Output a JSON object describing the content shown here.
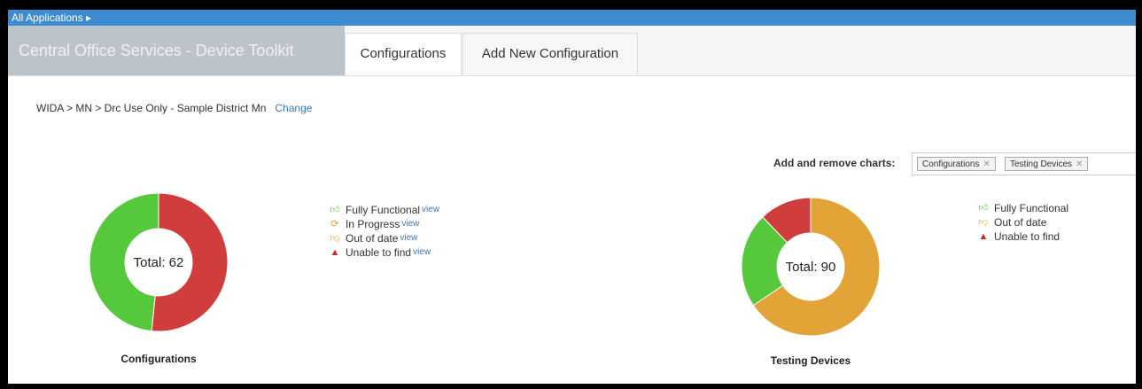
{
  "topbar": {
    "label": "All Applications ▸"
  },
  "app": {
    "title": "Central Office Services - Device Toolkit"
  },
  "tabs": [
    {
      "label": "Configurations",
      "active": true
    },
    {
      "label": "Add New Configuration",
      "active": false
    }
  ],
  "breadcrumb": {
    "path": "WIDA > MN > Drc Use Only - Sample District Mn",
    "change_label": "Change"
  },
  "add_charts": {
    "label": "Add and remove charts:",
    "tags": [
      "Configurations",
      "Testing Devices"
    ]
  },
  "colors": {
    "green": "#55c83c",
    "red": "#d13c3c",
    "orange": "#e2a437",
    "accent": "#3d8bd1"
  },
  "legends": {
    "configurations": [
      {
        "label": "Fully Functional",
        "link": "view",
        "icon": "thumbs-up-icon"
      },
      {
        "label": "In Progress",
        "link": "view",
        "icon": "refresh-icon"
      },
      {
        "label": "Out of date",
        "link": "view",
        "icon": "thumbs-down-icon"
      },
      {
        "label": "Unable to find",
        "link": "view",
        "icon": "warning-icon"
      }
    ],
    "testing": [
      {
        "label": "Fully Functional",
        "icon": "thumbs-up-icon"
      },
      {
        "label": "Out of date",
        "icon": "thumbs-down-icon"
      },
      {
        "label": "Unable to find",
        "icon": "warning-icon"
      }
    ]
  },
  "chart_data": [
    {
      "type": "pie",
      "title": "Configurations",
      "center_label": "Total: 62",
      "total": 62,
      "slices": [
        {
          "name": "Out of date",
          "value": 32,
          "color": "#d13c3c"
        },
        {
          "name": "Fully Functional",
          "value": 30,
          "color": "#55c83c"
        }
      ]
    },
    {
      "type": "pie",
      "title": "Testing Devices",
      "center_label": "Total: 90",
      "total": 90,
      "slices": [
        {
          "name": "Out of date",
          "value": 59,
          "color": "#e2a437"
        },
        {
          "name": "Fully Functional",
          "value": 20,
          "color": "#55c83c"
        },
        {
          "name": "Unable to find",
          "value": 11,
          "color": "#d13c3c"
        }
      ]
    }
  ]
}
